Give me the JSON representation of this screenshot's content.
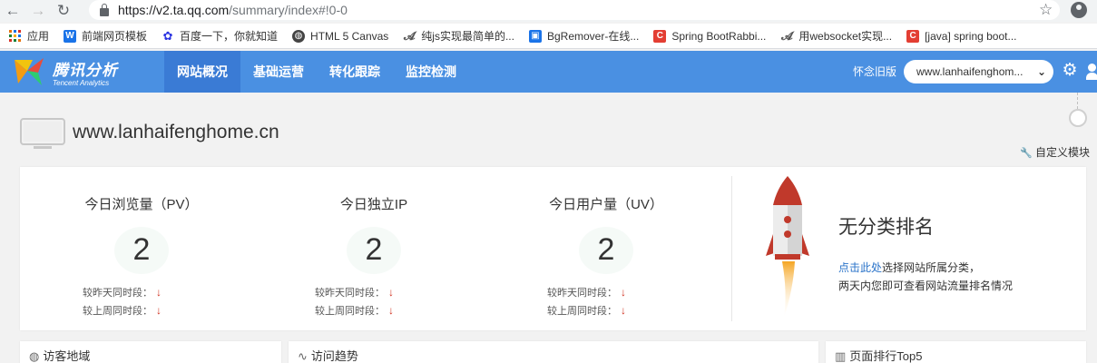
{
  "browser": {
    "url_host": "https://v2.ta.qq.com",
    "url_path": "/summary/index#!0-0"
  },
  "bookmarks": [
    {
      "label": "应用",
      "icon": "apps-grid-icon",
      "color": "#e8710a"
    },
    {
      "label": "前端网页模板",
      "icon": "template-site-icon",
      "color": "#1a73e8"
    },
    {
      "label": "百度一下，你就知道",
      "icon": "baidu-paw-icon",
      "color": "#2932e1"
    },
    {
      "label": "HTML 5 Canvas",
      "icon": "globe-icon",
      "color": "#444444"
    },
    {
      "label": "纯js实现最简单的...",
      "icon": "fish-logo-icon",
      "color": "#555555"
    },
    {
      "label": "BgRemover-在线...",
      "icon": "bgremover-icon",
      "color": "#1a73e8"
    },
    {
      "label": "Spring BootRabbi...",
      "icon": "csdn-c-icon",
      "color": "#e33e33"
    },
    {
      "label": "用websocket实现...",
      "icon": "fish-logo-icon",
      "color": "#555555"
    },
    {
      "label": "[java] spring boot...",
      "icon": "csdn-c-icon",
      "color": "#e33e33"
    }
  ],
  "header": {
    "logo_cn": "腾讯分析",
    "logo_en": "Tencent Analytics",
    "nav": [
      {
        "label": "网站概况",
        "active": true
      },
      {
        "label": "基础运营",
        "active": false
      },
      {
        "label": "转化跟踪",
        "active": false
      },
      {
        "label": "监控检测",
        "active": false
      }
    ],
    "old_version": "怀念旧版",
    "site_select": "www.lanhaifenghom...",
    "accent": "#4a90e2"
  },
  "site": {
    "title": "www.lanhaifenghome.cn",
    "custom_module": "自定义模块"
  },
  "stats": [
    {
      "label": "今日浏览量（PV）",
      "value": "2",
      "cmp_yesterday": "较昨天同时段：",
      "cmp_lastweek": "较上周同时段："
    },
    {
      "label": "今日独立IP",
      "value": "2",
      "cmp_yesterday": "较昨天同时段：",
      "cmp_lastweek": "较上周同时段："
    },
    {
      "label": "今日用户量（UV）",
      "value": "2",
      "cmp_yesterday": "较昨天同时段：",
      "cmp_lastweek": "较上周同时段："
    }
  ],
  "rank": {
    "title": "无分类排名",
    "link": "点击此处",
    "desc1": "选择网站所属分类，",
    "desc2": "两天内您即可查看网站流量排名情况"
  },
  "panels": [
    {
      "label": "访客地域",
      "icon": "globe-icon"
    },
    {
      "label": "访问趋势",
      "icon": "trend-line-icon"
    },
    {
      "label": "页面排行Top5",
      "icon": "bar-chart-icon"
    }
  ],
  "down_color": "#d0301f"
}
